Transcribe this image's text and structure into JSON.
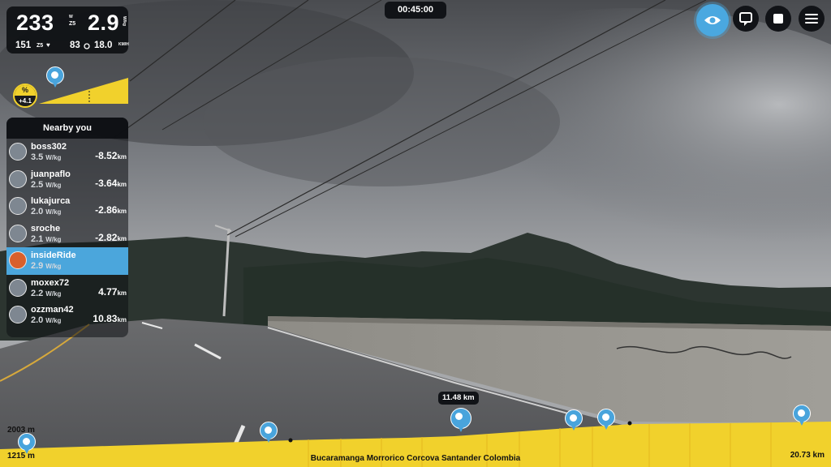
{
  "stats": {
    "power": "233",
    "power_unit": "W",
    "zone": "Z5",
    "wkg": "2.9",
    "wkg_unit": "W/kg",
    "heart_rate": "151",
    "hr_zone": "Z5",
    "cadence": "83",
    "speed": "18.0",
    "speed_unit": "KM/H"
  },
  "gradient": {
    "label": "%",
    "value": "+4.1"
  },
  "timer": "00:45:00",
  "nearby": {
    "title": "Nearby you",
    "riders": [
      {
        "name": "boss302",
        "wkg": "3.5",
        "unit": "W/kg",
        "dist": "-8.52",
        "dist_unit": "km"
      },
      {
        "name": "juanpaflo",
        "wkg": "2.5",
        "unit": "W/kg",
        "dist": "-3.64",
        "dist_unit": "km"
      },
      {
        "name": "lukajurca",
        "wkg": "2.0",
        "unit": "W/kg",
        "dist": "-2.86",
        "dist_unit": "km"
      },
      {
        "name": "sroche",
        "wkg": "2.1",
        "unit": "W/kg",
        "dist": "-2.82",
        "dist_unit": "km"
      },
      {
        "name": "insideRide",
        "wkg": "2.9",
        "unit": "W/kg",
        "dist": "",
        "dist_unit": ""
      },
      {
        "name": "moxex72",
        "wkg": "2.2",
        "unit": "W/kg",
        "dist": "4.77",
        "dist_unit": "km"
      },
      {
        "name": "ozzman42",
        "wkg": "2.0",
        "unit": "W/kg",
        "dist": "10.83",
        "dist_unit": "km"
      }
    ]
  },
  "controls": {
    "view_icon": "eye-icon",
    "switch_icon": "swap-icon",
    "stop_icon": "stop-icon",
    "menu_icon": "hamburger-icon"
  },
  "profile": {
    "max_elevation": "2003 m",
    "min_elevation": "1215 m",
    "route_name": "Bucaramanga Morrorico Corcova Santander Colombia",
    "total_distance": "20.73 km",
    "current_marker": "11.48 km"
  },
  "colors": {
    "accent": "#4aa8e0",
    "profile": "#f1d12c",
    "panel": "#111317"
  }
}
